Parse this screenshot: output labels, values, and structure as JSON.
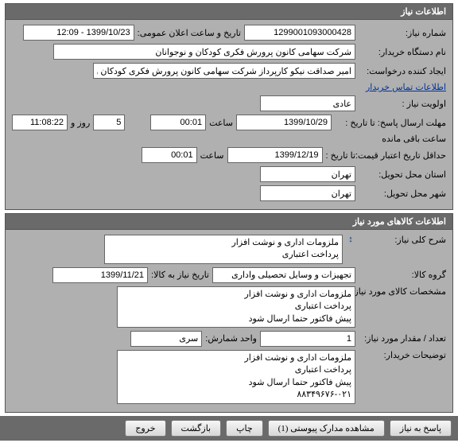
{
  "sections": {
    "need_info_title": "اطلاعات نیاز",
    "goods_info_title": "اطلاعات کالاهای مورد نیاز"
  },
  "labels": {
    "need_number": "شماره نیاز:",
    "public_announce_datetime": "تاریخ و ساعت اعلان عمومی:",
    "buyer_org": "نام دستگاه خریدار:",
    "request_creator": "ایجاد کننده درخواست:",
    "priority": "اولویت نیاز :",
    "reply_deadline": "مهلت ارسال پاسخ:  تا تاریخ :",
    "time": "ساعت",
    "day_and": "روز و",
    "remaining": "ساعت باقی مانده",
    "min_credit_date": "حداقل تاریخ اعتبار قیمت:",
    "until_date": "تا تاریخ :",
    "delivery_province": "استان محل تحویل:",
    "delivery_city": "شهر محل تحویل:",
    "general_desc": "شرح کلی نیاز:",
    "goods_group": "گروه کالا:",
    "need_by_date": "تاریخ نیاز به کالا:",
    "goods_spec": "مشخصات کالای مورد نیاز:",
    "qty": "تعداد / مقدار مورد نیاز:",
    "unit": "واحد شمارش:",
    "buyer_notes": "توضیحات خریدار:"
  },
  "values": {
    "need_number": "1299001093000428",
    "public_announce_datetime": "1399/10/23 - 12:09",
    "buyer_org": "شرکت سهامی کانون پرورش فکری کودکان و نوجوانان",
    "request_creator": "امیر صداقت نیکو کارپرداز شرکت سهامی کانون پرورش فکری کودکان و نوجوانان",
    "priority": "عادی",
    "reply_deadline_date": "1399/10/29",
    "reply_deadline_time": "00:01",
    "remaining_days": "5",
    "remaining_time": "11:08:22",
    "credit_until_date": "1399/12/19",
    "credit_until_time": "00:01",
    "province": "تهران",
    "city": "تهران",
    "general_desc": "ملزومات اداری و نوشت افزار\nپرداخت اعتباری",
    "goods_group": "تجهیزات و وسایل تحصیلی واداری",
    "need_by_date": "1399/11/21",
    "goods_spec": "ملزومات اداری و نوشت افزار\nپرداخت اعتباری\nپیش فاکتور حتما ارسال شود",
    "qty": "1",
    "unit": "سری",
    "buyer_notes": "ملزومات اداری و نوشت افزار\nپرداخت اعتباری\nپیش فاکتور حتما ارسال شود\n۸۸۳۴۹۶۷۶-۰۲۱"
  },
  "links": {
    "buyer_contact": "اطلاعات تماس خریدار"
  },
  "buttons": {
    "respond": "پاسخ به نیاز",
    "attachments": "مشاهده مدارک پیوستی (1)",
    "print": "چاپ",
    "back": "بازگشت",
    "exit": "خروج"
  },
  "icons": {
    "expand": "↕"
  }
}
